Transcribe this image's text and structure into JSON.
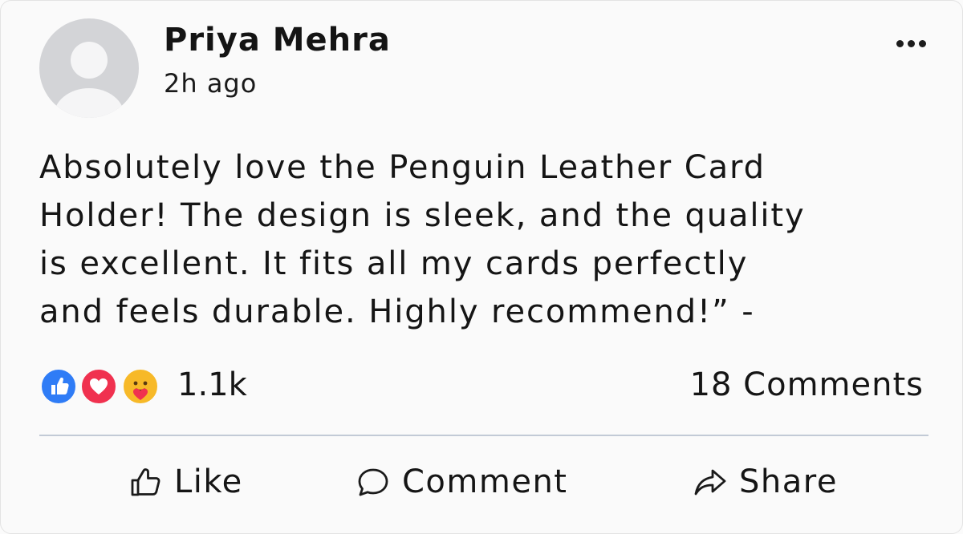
{
  "post": {
    "author": "Priya Mehra",
    "time": "2h ago",
    "text_lines": [
      "Absolutely love the Penguin Leather Card",
      "Holder! The design is sleek, and the quality",
      "is excellent. It fits all my cards perfectly",
      "and feels durable. Highly recommend!” -"
    ]
  },
  "reactions": {
    "count": "1.1k",
    "icons": [
      "like-reaction-icon",
      "love-reaction-icon",
      "care-reaction-icon"
    ],
    "colors": {
      "like": "#2f7cf6",
      "love": "#f0314f",
      "care": "#f7b928"
    }
  },
  "comments": {
    "count_label": "18 Comments"
  },
  "actions": {
    "like": {
      "label": "Like",
      "icon": "thumbs-up-icon"
    },
    "comment": {
      "label": "Comment",
      "icon": "speech-bubble-icon"
    },
    "share": {
      "label": "Share",
      "icon": "share-arrow-icon"
    }
  },
  "menu": {
    "icon": "more-options-icon"
  }
}
